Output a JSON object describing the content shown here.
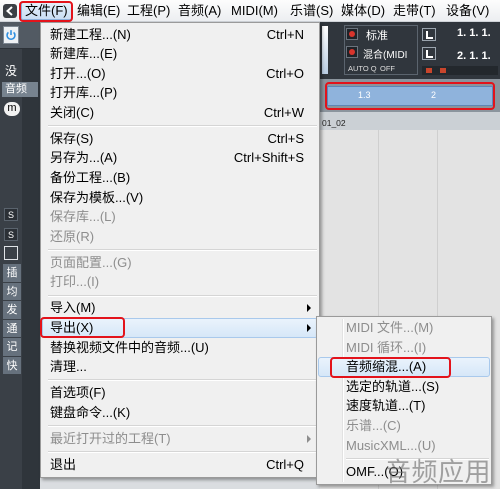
{
  "icons": {
    "logo": "cubase-logo-icon",
    "power": "power-icon",
    "submenu_arrow": "chevron-right-icon"
  },
  "colors": {
    "menu_background": "#f0f0f0",
    "menu_highlight": "#d6e7f8",
    "disabled_text": "#8d8d8d",
    "annotation_red": "#e3131b",
    "cycle_band": "#8fb3dc",
    "panel_dark": "#3a4047"
  },
  "menubar": {
    "items": [
      {
        "label": "文件(F)",
        "state": "open"
      },
      {
        "label": "编辑(E)"
      },
      {
        "label": "工程(P)"
      },
      {
        "label": "音频(A)"
      },
      {
        "label": "MIDI(M)"
      },
      {
        "label": "乐谱(S)"
      },
      {
        "label": "媒体(D)"
      },
      {
        "label": "走带(T)"
      },
      {
        "label": "设备(V)"
      }
    ]
  },
  "file_menu": {
    "groups": [
      {
        "items": [
          {
            "label": "新建工程...(N)",
            "shortcut": "Ctrl+N"
          },
          {
            "label": "新建库...(E)"
          },
          {
            "label": "打开...(O)",
            "shortcut": "Ctrl+O"
          },
          {
            "label": "打开库...(P)"
          },
          {
            "label": "关闭(C)",
            "shortcut": "Ctrl+W"
          }
        ]
      },
      {
        "items": [
          {
            "label": "保存(S)",
            "shortcut": "Ctrl+S"
          },
          {
            "label": "另存为...(A)",
            "shortcut": "Ctrl+Shift+S"
          },
          {
            "label": "备份工程...(B)"
          },
          {
            "label": "保存为模板...(V)"
          },
          {
            "label": "保存库...(L)",
            "disabled": true
          },
          {
            "label": "还原(R)",
            "disabled": true
          }
        ]
      },
      {
        "items": [
          {
            "label": "页面配置...(G)",
            "disabled": true
          },
          {
            "label": "打印...(I)",
            "disabled": true
          }
        ]
      },
      {
        "items": [
          {
            "label": "导入(M)",
            "submenu": true
          },
          {
            "label": "导出(X)",
            "submenu": true,
            "highlighted": true
          },
          {
            "label": "替换视频文件中的音频...(U)"
          },
          {
            "label": "清理..."
          }
        ]
      },
      {
        "items": [
          {
            "label": "首选项(F)"
          },
          {
            "label": "键盘命令...(K)"
          }
        ]
      },
      {
        "items": [
          {
            "label": "最近打开过的工程(T)",
            "submenu": true,
            "disabled": true
          }
        ]
      },
      {
        "items": [
          {
            "label": "退出",
            "shortcut": "Ctrl+Q"
          }
        ]
      }
    ]
  },
  "export_submenu": {
    "groups": [
      {
        "items": [
          {
            "label": "MIDI 文件...(M)",
            "disabled": true
          },
          {
            "label": "MIDI 循环...(I)",
            "disabled": true
          },
          {
            "label": "音频缩混...(A)",
            "highlighted": true
          },
          {
            "label": "选定的轨道...(S)"
          },
          {
            "label": "速度轨道...(T)"
          },
          {
            "label": "乐谱...(C)",
            "disabled": true
          },
          {
            "label": "MusicXML...(U)",
            "disabled": true
          }
        ]
      },
      {
        "items": [
          {
            "label": "OMF...(O)"
          }
        ]
      }
    ]
  },
  "background": {
    "left_panel": {
      "no_selection_text": "没",
      "audio_tab": "音频",
      "monitor_button": "m",
      "solo_buttons": [
        "S",
        "S"
      ],
      "section_tabs": [
        "插",
        "均",
        "发",
        "通",
        "记",
        "快"
      ]
    },
    "transport": {
      "mode_label": "标准",
      "mix_label": "混合(MIDI",
      "auto_q_label": "AUTO Q",
      "auto_q_value": "OFF",
      "left_locator": "1. 1. 1.",
      "right_locator": "2. 1. 1."
    },
    "ruler": {
      "marks": [
        "1.3",
        "2"
      ]
    },
    "track": {
      "event_name": "01_02"
    }
  },
  "watermark": "音频应用"
}
